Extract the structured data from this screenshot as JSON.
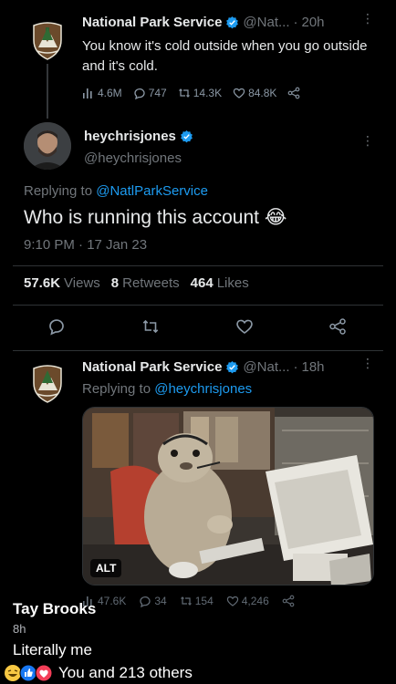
{
  "tweet1": {
    "name": "National Park Service",
    "handle": "@Nat...",
    "sep": "·",
    "time": "20h",
    "text": "You know it's cold outside when you go outside and it's cold.",
    "stats": {
      "views": "4.6M",
      "replies": "747",
      "retweets": "14.3K",
      "likes": "84.8K"
    }
  },
  "tweet2": {
    "name": "heychrisjones",
    "handle": "@heychrisjones",
    "replying_prefix": "Replying to ",
    "replying_handle": "@NatlParkService",
    "text": "Who is running this account",
    "emoji": "😂",
    "timestamp": "9:10 PM · 17 Jan 23",
    "views_count": "57.6K",
    "views_label": "Views",
    "retweets_count": "8",
    "retweets_label": "Retweets",
    "likes_count": "464",
    "likes_label": "Likes"
  },
  "tweet3": {
    "name": "National Park Service",
    "handle": "@Nat...",
    "sep": "·",
    "time": "18h",
    "replying_prefix": "Replying to ",
    "replying_handle": "@heychrisjones",
    "alt_badge": "ALT",
    "stats": {
      "views": "47.6K",
      "replies": "34",
      "retweets": "154",
      "likes": "4,246"
    }
  },
  "facebook": {
    "author": "Tay Brooks",
    "time": "8h",
    "caption": "Literally me",
    "reactions": "You and 213 others"
  },
  "colors": {
    "accent": "#1d9bf0",
    "muted": "#71767b",
    "background": "#000000"
  }
}
